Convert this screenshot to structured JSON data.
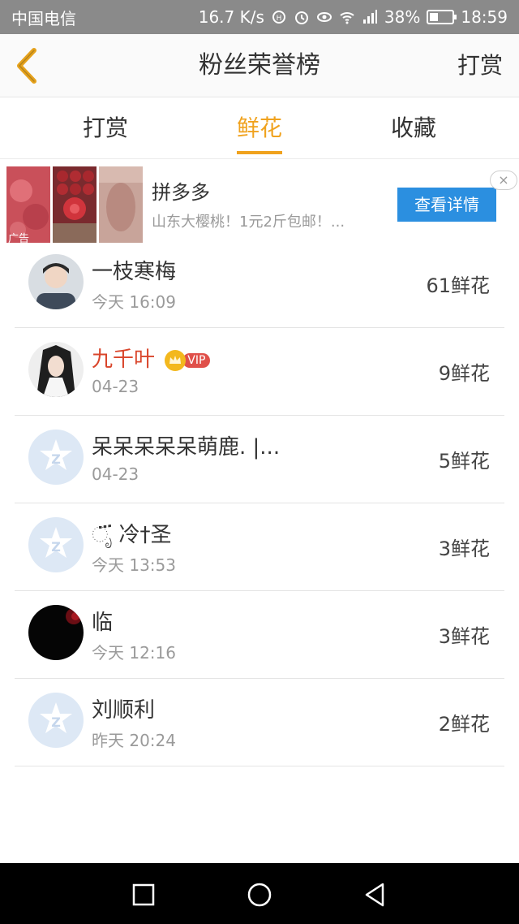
{
  "status_bar": {
    "carrier": "中国电信",
    "net_speed": "16.7 K/s",
    "network_type": "4G",
    "battery": "38%",
    "battery_level": 0.38,
    "time": "18:59"
  },
  "header": {
    "title": "粉丝荣誉榜",
    "action_label": "打赏"
  },
  "tabs": [
    {
      "label": "打赏",
      "active": false
    },
    {
      "label": "鲜花",
      "active": true
    },
    {
      "label": "收藏",
      "active": false
    }
  ],
  "ad": {
    "label": "广告",
    "title": "拼多多",
    "subtitle": "山东大樱桃！1元2斤包邮！...",
    "button_label": "查看详情",
    "close_label": "×"
  },
  "fans": [
    {
      "name": "一枝寒梅",
      "time": "今天 16:09",
      "count": "61鲜花",
      "avatar": "photo-boy",
      "vip": false
    },
    {
      "name": "九千叶",
      "time": "04-23",
      "count": "9鲜花",
      "avatar": "photo-costume",
      "vip": true,
      "vip_label": "VIP"
    },
    {
      "name": "呆呆呆呆呆萌鹿. |...",
      "time": "04-23",
      "count": "5鲜花",
      "avatar": "default",
      "vip": false
    },
    {
      "name": "ೃ፝ 冷†圣",
      "time": "今天 13:53",
      "count": "3鲜花",
      "avatar": "default",
      "vip": false
    },
    {
      "name": "临",
      "time": "今天 12:16",
      "count": "3鲜花",
      "avatar": "photo-dark",
      "vip": false
    },
    {
      "name": "刘顺利",
      "time": "昨天 20:24",
      "count": "2鲜花",
      "avatar": "default",
      "vip": false
    }
  ],
  "colors": {
    "accent": "#f0a21e",
    "vip_name": "#d9452b",
    "ad_button": "#2b8fe0",
    "status_bar": "#8a8a8a"
  }
}
